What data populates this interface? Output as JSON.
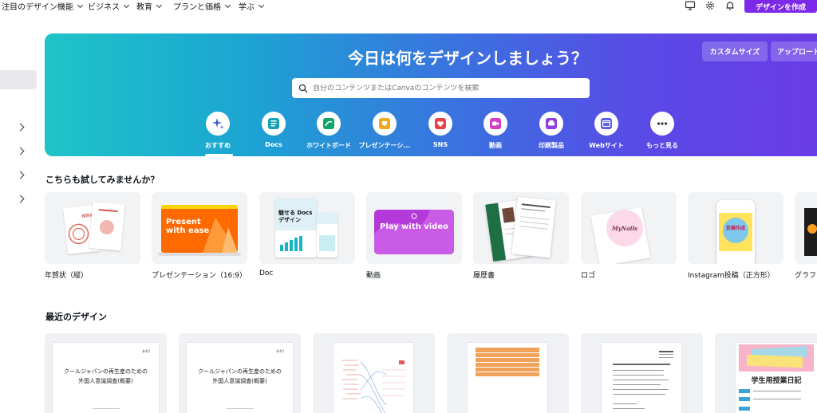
{
  "nav": {
    "items": [
      "注目のデザイン機能",
      "ビジネス",
      "教育",
      "プランと価格",
      "学ぶ"
    ],
    "create_button": "デザインを作成"
  },
  "hero": {
    "title": "今日は何をデザインしましょう？",
    "custom_size": "カスタムサイズ",
    "upload": "アップロード",
    "search_placeholder": "自分のコンテンツまたはCanvaのコンテンツを検索",
    "categories": [
      {
        "label": "おすすめ",
        "icon": "sparkle-icon"
      },
      {
        "label": "Docs",
        "icon": "docs-icon"
      },
      {
        "label": "ホワイトボード",
        "icon": "whiteboard-icon"
      },
      {
        "label": "プレゼンテーシ...",
        "icon": "presentation-icon"
      },
      {
        "label": "SNS",
        "icon": "heart-icon"
      },
      {
        "label": "動画",
        "icon": "video-icon"
      },
      {
        "label": "印刷製品",
        "icon": "print-icon"
      },
      {
        "label": "Webサイト",
        "icon": "website-icon"
      },
      {
        "label": "もっと見る",
        "icon": "more-icon"
      }
    ]
  },
  "try_section": {
    "title": "こちらも試してみませんか？",
    "cards": [
      {
        "label": "年賀状（縦）",
        "thumb_text": "謹賀新年"
      },
      {
        "label": "プレゼンテーション（16:9）",
        "thumb_text": "Present with ease"
      },
      {
        "label": "Doc",
        "thumb_text": "魅せる Docs デザイン"
      },
      {
        "label": "動画",
        "thumb_text": "Play with video"
      },
      {
        "label": "履歴書",
        "thumb_text": ""
      },
      {
        "label": "ロゴ",
        "thumb_text": "MyNails"
      },
      {
        "label": "Instagram投稿（正方形）",
        "thumb_text": "投稿作成"
      },
      {
        "label": "グラフ",
        "thumb_text": ""
      }
    ]
  },
  "recent_section": {
    "title": "最近のデザイン",
    "cards": [
      {
        "title_line1": "クールジャパンの再生産のための",
        "title_line2": "外国人意識調査(概要)"
      },
      {
        "title_line1": "クールジャパンの再生産のための",
        "title_line2": "外国人意識調査(概要)"
      },
      {
        "title_line1": "",
        "title_line2": ""
      },
      {
        "title_line1": "",
        "title_line2": ""
      },
      {
        "title_line1": "",
        "title_line2": ""
      },
      {
        "title_line1": "学生用授業日記",
        "title_line2": ""
      }
    ]
  },
  "colors": {
    "brand_purple": "#7d2ae8",
    "hero_start": "#1fc4c8",
    "hero_end": "#6a3ce6"
  }
}
